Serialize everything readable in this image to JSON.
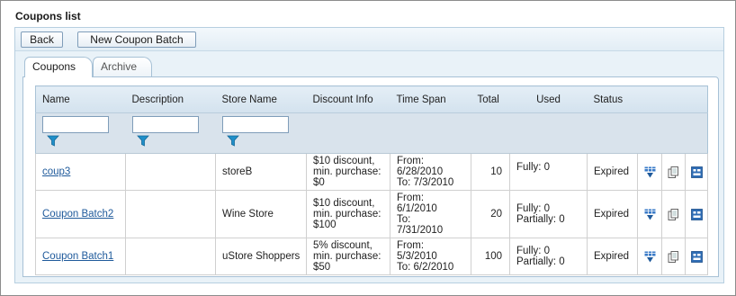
{
  "page_title": "Coupons list",
  "toolbar": {
    "back_label": "Back",
    "new_batch_label": "New Coupon Batch"
  },
  "tabs": [
    {
      "label": "Coupons",
      "active": true
    },
    {
      "label": "Archive",
      "active": false
    }
  ],
  "columns": {
    "name": "Name",
    "description": "Description",
    "store": "Store Name",
    "discount": "Discount Info",
    "timespan": "Time Span",
    "total": "Total",
    "used": "Used",
    "status": "Status"
  },
  "filters": {
    "name": "",
    "description": "",
    "store": ""
  },
  "rows": [
    {
      "name": "coup3",
      "description": "",
      "store": "storeB",
      "discount": [
        "$10 discount,",
        "min. purchase:",
        "$0"
      ],
      "timespan": [
        "From:",
        "6/28/2010",
        "To:  7/3/2010"
      ],
      "total": "10",
      "used": [
        "Fully: 0"
      ],
      "status": "Expired"
    },
    {
      "name": "Coupon Batch2",
      "description": "",
      "store": "Wine Store",
      "discount": [
        "$10 discount,",
        "min. purchase:",
        "$100"
      ],
      "timespan": [
        "From:",
        "6/1/2010",
        "To:",
        "7/31/2010"
      ],
      "total": "20",
      "used": [
        "Fully: 0",
        "Partially: 0"
      ],
      "status": "Expired"
    },
    {
      "name": "Coupon Batch1",
      "description": "",
      "store": "uStore Shoppers",
      "discount": [
        "5% discount,",
        "min. purchase:",
        "$50"
      ],
      "timespan": [
        "From:",
        "5/3/2010",
        "To:  6/2/2010"
      ],
      "total": "100",
      "used": [
        "Fully: 0",
        "Partially: 0"
      ],
      "status": "Expired"
    }
  ],
  "row_action_icons": [
    "download-codes-icon",
    "copy-icon",
    "details-icon"
  ],
  "colors": {
    "accent": "#1f5a9b",
    "header_bg": "#d3e2ee",
    "filter_bg": "#d9e3ec",
    "panel_bg": "#e9f2f8",
    "funnel": "#1f8ec8"
  }
}
